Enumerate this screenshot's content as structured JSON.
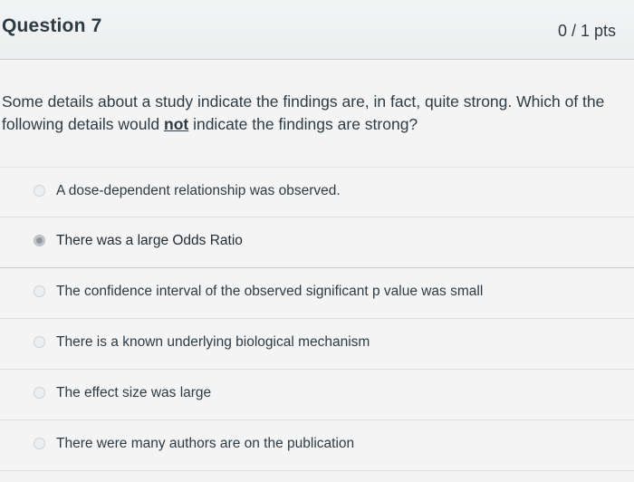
{
  "question": {
    "title": "Question 7",
    "points": "0 / 1 pts",
    "text_before": "Some details about a study indicate the findings are, in fact, quite strong.  Which of the following details would ",
    "text_emph": "not",
    "text_after": " indicate the findings are strong?"
  },
  "answers": [
    {
      "label": "A dose-dependent relationship was observed.",
      "selected": false
    },
    {
      "label": "There was a large Odds Ratio",
      "selected": true
    },
    {
      "label": "The confidence interval of the observed significant p value was small",
      "selected": false
    },
    {
      "label": "There is a known underlying biological mechanism",
      "selected": false
    },
    {
      "label": "The effect size was large",
      "selected": false
    },
    {
      "label": "There were many authors are on the publication",
      "selected": false
    }
  ]
}
